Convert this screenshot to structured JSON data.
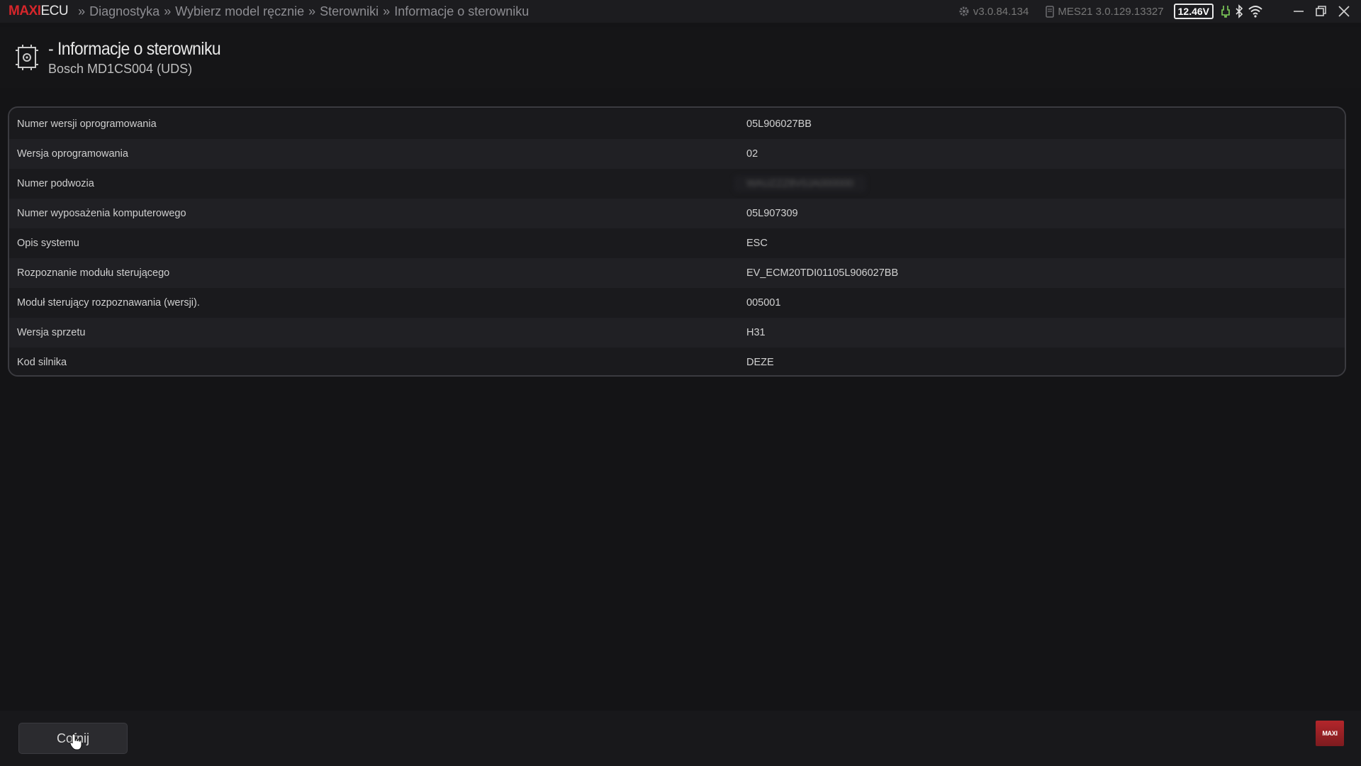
{
  "topbar": {
    "brand_red": "MAXI",
    "brand_white": "ECU",
    "breadcrumbs": [
      "Diagnostyka",
      "Wybierz model ręcznie",
      "Sterowniki",
      "Informacje o sterowniku"
    ],
    "separator": "»",
    "app_version": "v3.0.84.134",
    "device_version": "MES21 3.0.129.13327",
    "voltage": "12.46V"
  },
  "header": {
    "title": "- Informacje o sterowniku",
    "subtitle": "Bosch MD1CS004 (UDS)"
  },
  "table": {
    "rows": [
      {
        "label": "Numer wersji oprogramowania",
        "value": "05L906027BB"
      },
      {
        "label": "Wersja oprogramowania",
        "value": "02"
      },
      {
        "label": "Numer podwozia",
        "value": "WAUZZZ8V0JA000000"
      },
      {
        "label": "Numer wyposażenia komputerowego",
        "value": "05L907309"
      },
      {
        "label": "Opis systemu",
        "value": "ESC"
      },
      {
        "label": "Rozpoznanie modułu sterującego",
        "value": "EV_ECM20TDI01105L906027BB"
      },
      {
        "label": "Moduł sterujący rozpoznawania (wersji).",
        "value": "005001"
      },
      {
        "label": "Wersja sprzetu",
        "value": "H31"
      },
      {
        "label": "Kod silnika",
        "value": "DEZE"
      }
    ]
  },
  "footer": {
    "back_label": "Cofnij",
    "logo_text": "MAXI"
  },
  "colors": {
    "brand_red": "#d6262b",
    "background": "#141416",
    "row_alt": "#202024"
  }
}
